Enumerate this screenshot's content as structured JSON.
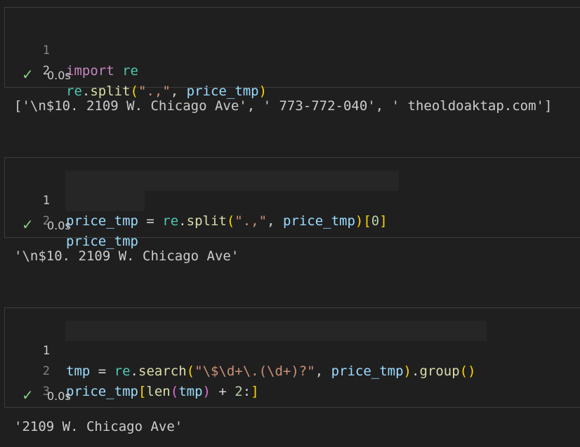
{
  "cells": [
    {
      "lines": [
        {
          "n": "1",
          "t": [
            {
              "c": "kw-import",
              "v": "import"
            },
            {
              "c": "pl",
              "v": " "
            },
            {
              "c": "mod",
              "v": "re"
            }
          ]
        },
        {
          "n": "2",
          "t": [
            {
              "c": "mod",
              "v": "re"
            },
            {
              "c": "pl",
              "v": "."
            },
            {
              "c": "fn",
              "v": "split"
            },
            {
              "c": "p1",
              "v": "("
            },
            {
              "c": "str",
              "v": "\".,\""
            },
            {
              "c": "pl",
              "v": ", "
            },
            {
              "c": "var",
              "v": "price_tmp"
            },
            {
              "c": "p1",
              "v": ")"
            }
          ]
        }
      ],
      "status": {
        "time": "0.0s"
      },
      "output": "['\\n$10. 2109 W. Chicago Ave', ' 773-772-040', ' theoldoaktap.com']"
    },
    {
      "lines": [
        {
          "n": "1",
          "t": [
            {
              "c": "var",
              "v": "price_tmp"
            },
            {
              "c": "op",
              "v": " = "
            },
            {
              "c": "mod",
              "v": "re"
            },
            {
              "c": "pl",
              "v": "."
            },
            {
              "c": "fn",
              "v": "split"
            },
            {
              "c": "p1",
              "v": "("
            },
            {
              "c": "str",
              "v": "\".,\""
            },
            {
              "c": "pl",
              "v": ", "
            },
            {
              "c": "var",
              "v": "price_tmp"
            },
            {
              "c": "p1",
              "v": ")"
            },
            {
              "c": "p1",
              "v": "["
            },
            {
              "c": "num",
              "v": "0"
            },
            {
              "c": "p1",
              "v": "]"
            }
          ]
        },
        {
          "n": "2",
          "t": [
            {
              "c": "var",
              "v": "price_tmp"
            }
          ]
        }
      ],
      "status": {
        "time": "0.0s"
      },
      "output": "'\\n$10. 2109 W. Chicago Ave'"
    },
    {
      "lines": [
        {
          "n": "1",
          "t": [
            {
              "c": "var",
              "v": "tmp"
            },
            {
              "c": "op",
              "v": " = "
            },
            {
              "c": "mod",
              "v": "re"
            },
            {
              "c": "pl",
              "v": "."
            },
            {
              "c": "fn",
              "v": "search"
            },
            {
              "c": "p1",
              "v": "("
            },
            {
              "c": "str",
              "v": "\"\\$\\d+\\.(\\d+)?\""
            },
            {
              "c": "pl",
              "v": ", "
            },
            {
              "c": "var",
              "v": "price_tmp"
            },
            {
              "c": "p1",
              "v": ")"
            },
            {
              "c": "pl",
              "v": "."
            },
            {
              "c": "fn",
              "v": "group"
            },
            {
              "c": "p1",
              "v": "()"
            }
          ]
        },
        {
          "n": "2",
          "t": [
            {
              "c": "var",
              "v": "price_tmp"
            },
            {
              "c": "p1",
              "v": "["
            },
            {
              "c": "fn",
              "v": "len"
            },
            {
              "c": "p2",
              "v": "("
            },
            {
              "c": "var",
              "v": "tmp"
            },
            {
              "c": "p2",
              "v": ")"
            },
            {
              "c": "op",
              "v": " + "
            },
            {
              "c": "num",
              "v": "2"
            },
            {
              "c": "pl",
              "v": ":"
            },
            {
              "c": "p1",
              "v": "]"
            }
          ]
        },
        {
          "n": "3",
          "t": []
        }
      ],
      "status": {
        "time": "0.0s"
      },
      "output": "'2109 W. Chicago Ave'"
    }
  ],
  "icons": {
    "status": "checkmark-icon"
  },
  "colors": {
    "keyword": "#c586c0",
    "module": "#4ec9b0",
    "variable": "#9cdcfe",
    "function": "#dcdcaa",
    "string": "#ce9178",
    "number": "#b5cea8",
    "bracket": "#ffd700",
    "check": "#89d185"
  }
}
